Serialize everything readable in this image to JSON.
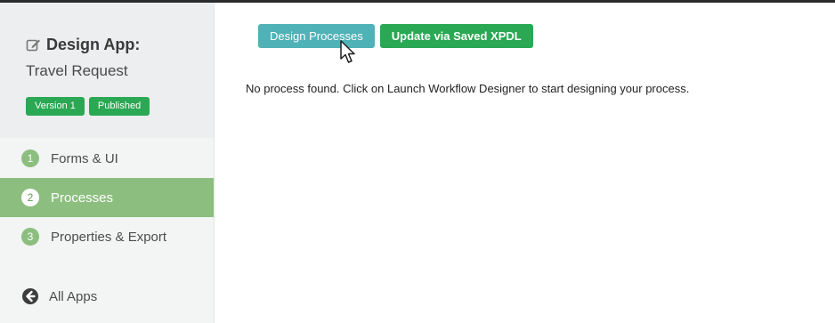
{
  "sidebar": {
    "title": "Design App:",
    "app_name": "Travel Request",
    "version_badge": "Version 1",
    "status_badge": "Published",
    "items": [
      {
        "number": "1",
        "label": "Forms & UI"
      },
      {
        "number": "2",
        "label": "Processes"
      },
      {
        "number": "3",
        "label": "Properties & Export"
      }
    ],
    "active_item": "Processes",
    "back_label": "All Apps"
  },
  "toolbar": {
    "design_label": "Design Processes",
    "xpdl_label": "Update via Saved XPDL"
  },
  "main": {
    "message": "No process found. Click on Launch Workflow Designer to start designing your process."
  },
  "icons": {
    "title": "edit-icon",
    "back": "arrow-left-circle-icon",
    "pointer": "mouse-cursor-icon"
  },
  "colors": {
    "accent_green": "#2aa853",
    "menu_active": "#8cbf7f",
    "design_button": "#4fb2b6"
  }
}
